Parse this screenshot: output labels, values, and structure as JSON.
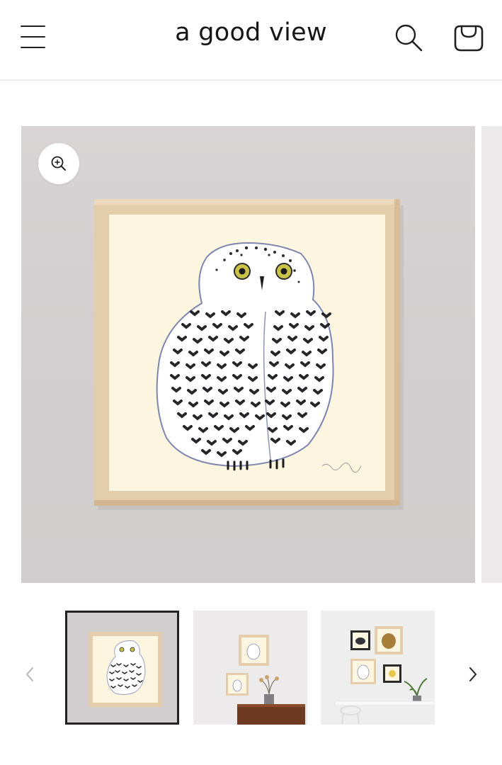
{
  "header": {
    "store_name": "a good view",
    "menu_icon": "hamburger-menu-icon",
    "search_icon": "search-icon",
    "cart_icon": "cart-bag-icon"
  },
  "gallery": {
    "main_image": "snowy-owl-framed-print-on-wall",
    "zoom_icon": "zoom-in-icon",
    "thumbnails": [
      {
        "image": "snowy-owl-framed-print-closeup",
        "active": true
      },
      {
        "image": "two-owl-prints-above-cabinet",
        "active": false
      },
      {
        "image": "gallery-wall-with-owl-prints",
        "active": false
      }
    ],
    "prev_icon": "chevron-left-icon",
    "next_icon": "chevron-right-icon"
  },
  "colors": {
    "text": "#161616",
    "wall": "#d3cfd0",
    "frame": "#e6cfae",
    "mat": "#fbf5e0",
    "active_thumb_border": "#222222"
  }
}
